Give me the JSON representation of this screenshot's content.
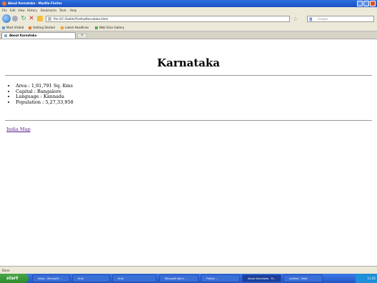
{
  "window": {
    "title": "About Karnataka - Mozilla Firefox"
  },
  "menu": [
    "File",
    "Edit",
    "View",
    "History",
    "Bookmarks",
    "Tools",
    "Help"
  ],
  "nav": {
    "url": "file:///C:/Sakthi/Firefox/Karnataka.html",
    "search_placeholder": "Google"
  },
  "bookmarks": [
    "Most Visited",
    "Getting Started",
    "Latest Headlines",
    "Web Slice Gallery"
  ],
  "tabs": [
    {
      "label": "About Karnataka"
    }
  ],
  "page": {
    "heading": "Karnataka",
    "facts": [
      "Area : 1,91,791 Sq. Kms",
      "Capital : Bangalore",
      "Language : Kannada",
      "Population : 5,27,33,958"
    ],
    "link": "India Map"
  },
  "status": "Done",
  "taskbar": {
    "start": "start",
    "tasks": [
      "Inbox - Microsoft ...",
      "html",
      "html",
      "Microsoft Word ...",
      "Firefox ...",
      "About Karnataka - M...",
      "untitled - Paint"
    ],
    "clock": "11:45"
  }
}
